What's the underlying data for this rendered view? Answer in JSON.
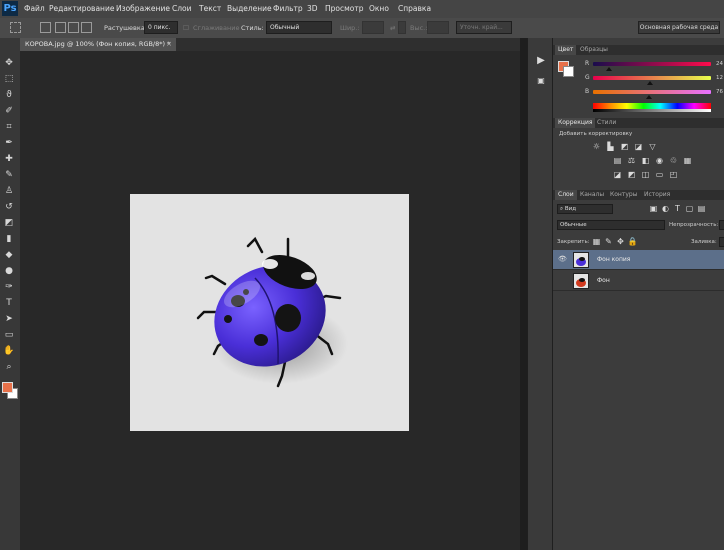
{
  "app": {
    "logo": "Ps"
  },
  "menu": [
    "Файл",
    "Редактирование",
    "Изображение",
    "Слои",
    "Текст",
    "Выделение",
    "Фильтр",
    "3D",
    "Просмотр",
    "Окно",
    "Справка"
  ],
  "options": {
    "feather_label": "Растушевка:",
    "feather_value": "0 пикс.",
    "antialias_label": "Сглаживание",
    "style_label": "Стиль:",
    "style_value": "Обычный",
    "width_label": "Шир.:",
    "height_label": "Выс.:",
    "refine_label": "Уточн. край...",
    "workspace": "Основная рабочая среда"
  },
  "document": {
    "tab_title": "КОРОВА.jpg @ 100% (Фон копия, RGB/8*) *",
    "close": "×"
  },
  "tools": [
    "move-tool",
    "marquee-tool",
    "lasso-tool",
    "quick-select-tool",
    "crop-tool",
    "eyedropper-tool",
    "healing-brush-tool",
    "brush-tool",
    "clone-stamp-tool",
    "history-brush-tool",
    "eraser-tool",
    "gradient-tool",
    "blur-tool",
    "dodge-tool",
    "pen-tool",
    "type-tool",
    "path-select-tool",
    "shape-tool",
    "hand-tool",
    "zoom-tool"
  ],
  "colors": {
    "foreground": "#e8714a",
    "background": "#ffffff",
    "ladybug_body": "#4a2fd8",
    "canvas": "#e3e3e3"
  },
  "color_panel": {
    "tabs": [
      "Цвет",
      "Образцы"
    ],
    "sliders": [
      {
        "label": "R",
        "value": "24"
      },
      {
        "label": "G",
        "value": "12"
      },
      {
        "label": "B",
        "value": "76"
      }
    ]
  },
  "adjustments_panel": {
    "tabs": [
      "Коррекция",
      "Стили"
    ],
    "heading": "Добавить корректировку",
    "icons": [
      "brightness-icon",
      "levels-icon",
      "curves-icon",
      "exposure-icon",
      "vibrance-icon",
      "hue-sat-icon",
      "color-balance-icon",
      "bw-icon",
      "photo-filter-icon",
      "channel-mixer-icon",
      "color-lookup-icon",
      "invert-icon",
      "posterize-icon",
      "threshold-icon",
      "gradient-map-icon",
      "selective-color-icon"
    ]
  },
  "layers_panel": {
    "tabs": [
      "Слои",
      "Каналы",
      "Контуры",
      "История"
    ],
    "filter_value": "Вид",
    "blend_value": "Обычные",
    "opacity_label": "Непрозрачность:",
    "lock_label": "Закрепить:",
    "fill_label": "Заливка:",
    "layers": [
      {
        "name": "Фон копия",
        "selected": true
      },
      {
        "name": "Фон",
        "selected": false
      }
    ]
  }
}
